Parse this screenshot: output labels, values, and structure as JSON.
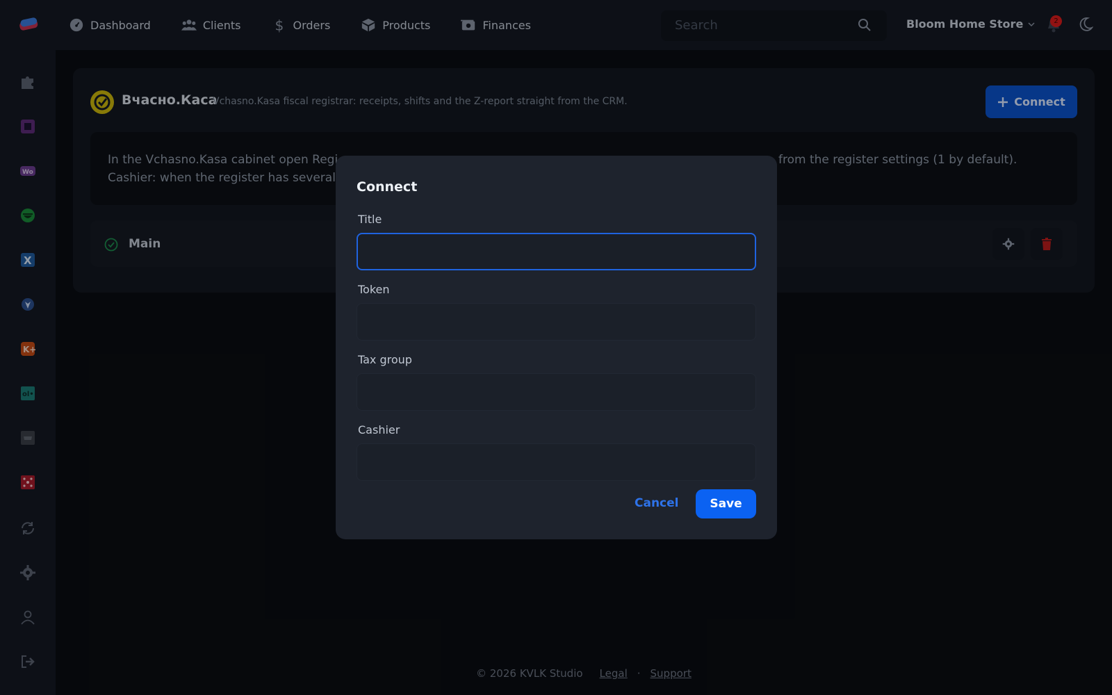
{
  "nav": {
    "items": [
      {
        "label": "Dashboard",
        "icon": "dashboard-icon"
      },
      {
        "label": "Clients",
        "icon": "users-icon"
      },
      {
        "label": "Orders",
        "icon": "dollar-icon"
      },
      {
        "label": "Products",
        "icon": "box-icon"
      },
      {
        "label": "Finances",
        "icon": "money-icon"
      }
    ],
    "search_placeholder": "Search",
    "store_name": "Bloom Home Store",
    "notification_count": "2"
  },
  "integration": {
    "name": "Вчасно.Каса",
    "description": "Vchasno.Kasa fiscal registrar: receipts, shifts and the Z-report straight from the CRM.",
    "connect_label": "Connect",
    "info_line1_left": "In the Vchasno.Kasa cabinet open Regi",
    "info_line1_right": "from the register settings (1 by default).",
    "info_line2": "Cashier: when the register has several",
    "connection_name": "Main"
  },
  "modal": {
    "title": "Connect",
    "fields": [
      {
        "label": "Title",
        "value": ""
      },
      {
        "label": "Token",
        "value": ""
      },
      {
        "label": "Tax group",
        "value": ""
      },
      {
        "label": "Cashier",
        "value": ""
      }
    ],
    "cancel_label": "Cancel",
    "save_label": "Save"
  },
  "footer": {
    "copyright": "© 2026 KVLK Studio",
    "legal": "Legal",
    "separator": "·",
    "support": "Support"
  },
  "colors": {
    "accent": "#0b62f2",
    "danger": "#d81b1b",
    "background": "#0a0d12",
    "panel": "#141922"
  }
}
